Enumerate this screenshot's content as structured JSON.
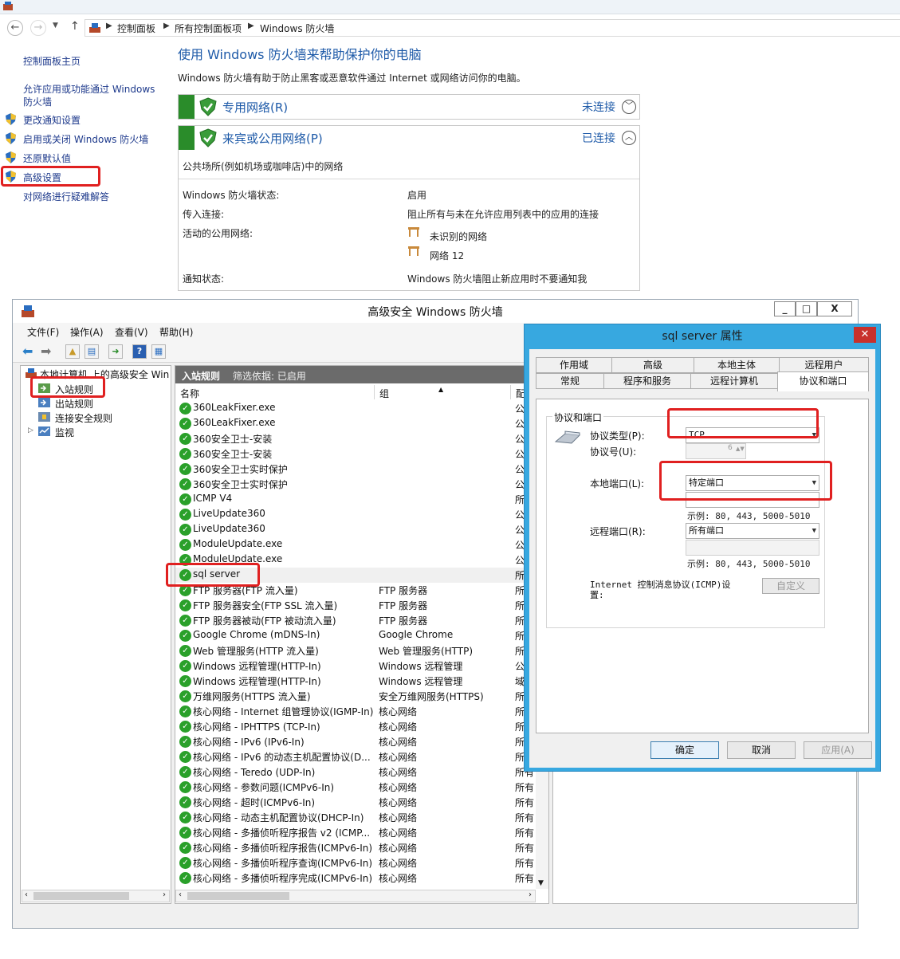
{
  "control_panel": {
    "breadcrumb": [
      "控制面板",
      "所有控制面板项",
      "Windows 防火墙"
    ],
    "sidebar": {
      "home": "控制面板主页",
      "allow_app": "允许应用或功能通过 Windows 防火墙",
      "items": [
        "更改通知设置",
        "启用或关闭 Windows 防火墙",
        "还原默认值",
        "高级设置"
      ],
      "troubleshoot": "对网络进行疑难解答"
    },
    "heading": "使用 Windows 防火墙来帮助保护你的电脑",
    "description": "Windows 防火墙有助于防止黑客或恶意软件通过 Internet 或网络访问你的电脑。",
    "private_network": {
      "title": "专用网络(R)",
      "status": "未连接"
    },
    "public_network": {
      "title": "来宾或公用网络(P)",
      "status": "已连接",
      "subtitle": "公共场所(例如机场或咖啡店)中的网络",
      "rows": [
        {
          "label": "Windows 防火墙状态:",
          "value": "启用"
        },
        {
          "label": "传入连接:",
          "value": "阻止所有与未在允许应用列表中的应用的连接"
        },
        {
          "label": "活动的公用网络:",
          "value": "未识别的网络"
        },
        {
          "label": "",
          "value": "网络 12"
        },
        {
          "label": "通知状态:",
          "value": "Windows 防火墙阻止新应用时不要通知我"
        }
      ]
    }
  },
  "mmc": {
    "title": "高级安全 Windows 防火墙",
    "window_buttons": [
      "_",
      "□",
      "X"
    ],
    "menu": [
      "文件(F)",
      "操作(A)",
      "查看(V)",
      "帮助(H)"
    ],
    "tree": {
      "root": "本地计算机 上的高级安全 Win",
      "items": [
        "入站规则",
        "出站规则",
        "连接安全规则",
        "监视"
      ]
    },
    "list": {
      "title": "入站规则",
      "filter": "筛选依据: 已启用",
      "columns": [
        "名称",
        "组",
        "配"
      ],
      "rows": [
        {
          "name": "360LeakFixer.exe",
          "group": "",
          "profile": "公"
        },
        {
          "name": "360LeakFixer.exe",
          "group": "",
          "profile": "公"
        },
        {
          "name": "360安全卫士-安装",
          "group": "",
          "profile": "公"
        },
        {
          "name": "360安全卫士-安装",
          "group": "",
          "profile": "公"
        },
        {
          "name": "360安全卫士实时保护",
          "group": "",
          "profile": "公"
        },
        {
          "name": "360安全卫士实时保护",
          "group": "",
          "profile": "公"
        },
        {
          "name": "ICMP V4",
          "group": "",
          "profile": "所"
        },
        {
          "name": "LiveUpdate360",
          "group": "",
          "profile": "公"
        },
        {
          "name": "LiveUpdate360",
          "group": "",
          "profile": "公"
        },
        {
          "name": "ModuleUpdate.exe",
          "group": "",
          "profile": "公"
        },
        {
          "name": "ModuleUpdate.exe",
          "group": "",
          "profile": "公"
        },
        {
          "name": "sql server",
          "group": "",
          "profile": "所"
        },
        {
          "name": "FTP 服务器(FTP 流入量)",
          "group": "FTP 服务器",
          "profile": "所"
        },
        {
          "name": "FTP 服务器安全(FTP SSL 流入量)",
          "group": "FTP 服务器",
          "profile": "所"
        },
        {
          "name": "FTP 服务器被动(FTP 被动流入量)",
          "group": "FTP 服务器",
          "profile": "所"
        },
        {
          "name": "Google Chrome (mDNS-In)",
          "group": "Google Chrome",
          "profile": "所"
        },
        {
          "name": "Web 管理服务(HTTP 流入量)",
          "group": "Web 管理服务(HTTP)",
          "profile": "所"
        },
        {
          "name": "Windows 远程管理(HTTP-In)",
          "group": "Windows 远程管理",
          "profile": "公"
        },
        {
          "name": "Windows 远程管理(HTTP-In)",
          "group": "Windows 远程管理",
          "profile": "域"
        },
        {
          "name": "万维网服务(HTTPS 流入量)",
          "group": "安全万维网服务(HTTPS)",
          "profile": "所"
        },
        {
          "name": "核心网络 - Internet 组管理协议(IGMP-In)",
          "group": "核心网络",
          "profile": "所"
        },
        {
          "name": "核心网络 - IPHTTPS (TCP-In)",
          "group": "核心网络",
          "profile": "所"
        },
        {
          "name": "核心网络 - IPv6 (IPv6-In)",
          "group": "核心网络",
          "profile": "所"
        },
        {
          "name": "核心网络 - IPv6 的动态主机配置协议(D...",
          "group": "核心网络",
          "profile": "所"
        },
        {
          "name": "核心网络 - Teredo (UDP-In)",
          "group": "核心网络",
          "profile": "所有"
        },
        {
          "name": "核心网络 - 参数问题(ICMPv6-In)",
          "group": "核心网络",
          "profile": "所有"
        },
        {
          "name": "核心网络 - 超时(ICMPv6-In)",
          "group": "核心网络",
          "profile": "所有"
        },
        {
          "name": "核心网络 - 动态主机配置协议(DHCP-In)",
          "group": "核心网络",
          "profile": "所有"
        },
        {
          "name": "核心网络 - 多播侦听程序报告 v2 (ICMP...",
          "group": "核心网络",
          "profile": "所有"
        },
        {
          "name": "核心网络 - 多播侦听程序报告(ICMPv6-In)",
          "group": "核心网络",
          "profile": "所有"
        },
        {
          "name": "核心网络 - 多播侦听程序查询(ICMPv6-In)",
          "group": "核心网络",
          "profile": "所有"
        },
        {
          "name": "核心网络 - 多播侦听程序完成(ICMPv6-In)",
          "group": "核心网络",
          "profile": "所有"
        }
      ]
    }
  },
  "dialog": {
    "title": "sql server 属性",
    "close": "✕",
    "tabs_row1": [
      "作用域",
      "高级",
      "本地主体",
      "远程用户"
    ],
    "tabs_row2": [
      "常规",
      "程序和服务",
      "远程计算机",
      "协议和端口"
    ],
    "group_title": "协议和端口",
    "protocol_type_label": "协议类型(P):",
    "protocol_type_value": "TCP",
    "protocol_number_label": "协议号(U):",
    "protocol_number_value": "6",
    "local_port_label": "本地端口(L):",
    "local_port_value": "特定端口",
    "local_port_example": "示例: 80, 443, 5000-5010",
    "remote_port_label": "远程端口(R):",
    "remote_port_value": "所有端口",
    "remote_port_example": "示例: 80, 443, 5000-5010",
    "icmp_label": "Internet 控制消息协议(ICMP)设置:",
    "customize_button": "自定义",
    "ok_button": "确定",
    "cancel_button": "取消",
    "apply_button": "应用(A)"
  },
  "colors": {
    "link": "#1e3a8c",
    "heading": "#1e5aa8",
    "annotation": "#e02020",
    "firewall_green": "#2a8c2a",
    "dialog_frame": "#37a8e0"
  }
}
